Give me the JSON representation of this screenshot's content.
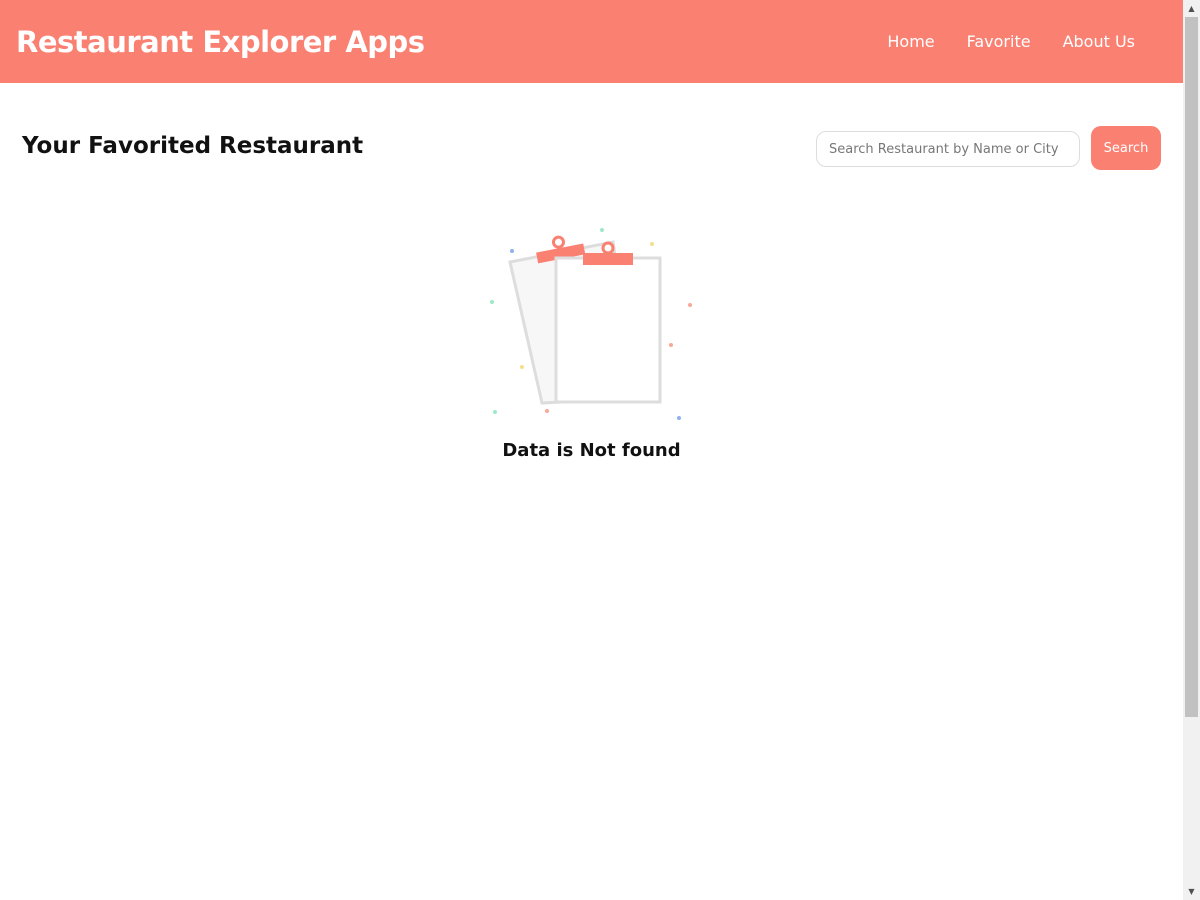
{
  "header": {
    "brand": "Restaurant Explorer Apps",
    "nav": [
      "Home",
      "Favorite",
      "About Us"
    ]
  },
  "main": {
    "title": "Your Favorited Restaurant",
    "search_placeholder": "Search Restaurant by Name or City",
    "search_label": "Search",
    "empty_message": "Data is Not found"
  },
  "colors": {
    "accent": "#fa8072"
  }
}
